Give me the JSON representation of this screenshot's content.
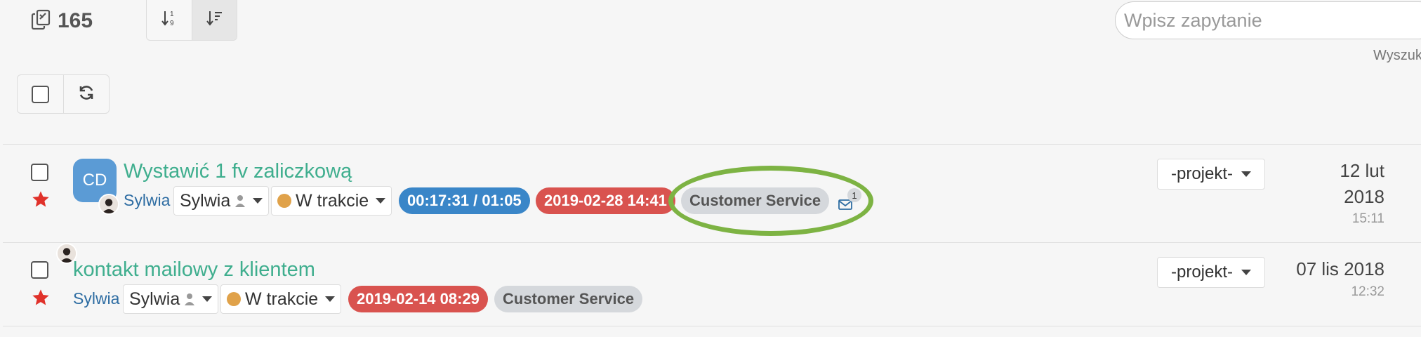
{
  "toolbar": {
    "count": "165",
    "search_placeholder": "Wpisz zapytanie",
    "search_hint": "Wyszukaj"
  },
  "tasks": [
    {
      "avatar_initials": "CD",
      "title": "Wystawić 1 fv zaliczkową",
      "user_link": "Sylwia",
      "assignee": "Sylwia",
      "status": "W trakcie",
      "timer": "00:17:31 / 01:05",
      "deadline": "2019-02-28 14:41",
      "category": "Customer Service",
      "mail_count": "1",
      "project": "-projekt-",
      "date_line1": "12 lut",
      "date_line2": "2018",
      "time": "15:11"
    },
    {
      "title": "kontakt mailowy z klientem",
      "user_link": "Sylwia",
      "assignee": "Sylwia",
      "status": "W trakcie",
      "deadline": "2019-02-14 08:29",
      "category": "Customer Service",
      "project": "-projekt-",
      "date_line1": "07 lis 2018",
      "time": "12:32"
    }
  ],
  "colors": {
    "title_green": "#3fae8e",
    "link_blue": "#2d6ca2",
    "timer_blue": "#3a86c8",
    "deadline_red": "#d9534f",
    "status_orange": "#e0a24a",
    "highlight_green": "#7db343",
    "star_red": "#e0312a"
  }
}
